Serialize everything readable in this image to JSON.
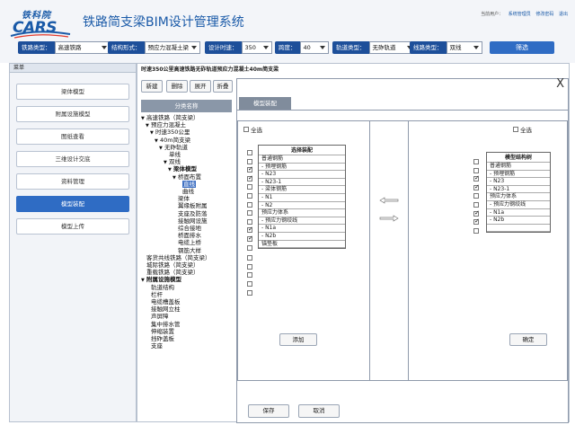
{
  "app": {
    "logo_cn": "铁科院",
    "logo_en": "CARS",
    "title": "铁路简支梁BIM设计管理系统"
  },
  "user": {
    "welcome": "当前用户：",
    "links": [
      "系统管理员",
      "修改密码",
      "退出"
    ]
  },
  "filters": [
    {
      "label": "铁路类型：",
      "value": "高速铁路"
    },
    {
      "label": "结构形式：",
      "value": "预应力混凝土梁"
    },
    {
      "label": "设计时速：",
      "value": "350"
    },
    {
      "label": "跨度：",
      "value": "40"
    },
    {
      "label": "轨道类型：",
      "value": "无砟轨道"
    },
    {
      "label": "线路类型：",
      "value": "双线"
    }
  ],
  "filter_button": "筛选",
  "sidebar": {
    "header": "菜单",
    "items": [
      {
        "label": "梁体模型",
        "active": false
      },
      {
        "label": "附属设施模型",
        "active": false
      },
      {
        "label": "图纸查看",
        "active": false
      },
      {
        "label": "三维设计交底",
        "active": false
      },
      {
        "label": "资料管理",
        "active": false
      },
      {
        "label": "模型装配",
        "active": true
      },
      {
        "label": "模型上传",
        "active": false
      }
    ]
  },
  "breadcrumb": "时速350公里高速铁路无砟轨道预应力混凝土40m简支梁",
  "tree_toolbar": [
    "新建",
    "删除",
    "展开",
    "折叠"
  ],
  "tree_header": "分类名称",
  "tree": [
    {
      "label": "高速铁路（简支梁）",
      "level": 0,
      "arrow": "▼",
      "bold": false,
      "selected": false
    },
    {
      "label": "预应力混凝土",
      "level": 1,
      "arrow": "▼",
      "bold": false,
      "selected": false
    },
    {
      "label": "时速350公里",
      "level": 2,
      "arrow": "▼",
      "bold": false,
      "selected": false
    },
    {
      "label": "40m简支梁",
      "level": 3,
      "arrow": "▼",
      "bold": false,
      "selected": false
    },
    {
      "label": "无砟轨道",
      "level": 4,
      "arrow": "▼",
      "bold": false,
      "selected": false
    },
    {
      "label": "单线",
      "level": 5,
      "arrow": "",
      "bold": false,
      "selected": false
    },
    {
      "label": "双线",
      "level": 5,
      "arrow": "▼",
      "bold": false,
      "selected": false
    },
    {
      "label": "梁体模型",
      "level": 6,
      "arrow": "▼",
      "bold": true,
      "selected": false
    },
    {
      "label": "桥面布置",
      "level": 7,
      "arrow": "▼",
      "bold": false,
      "selected": false
    },
    {
      "label": "直线",
      "level": 8,
      "arrow": "",
      "bold": false,
      "selected": true
    },
    {
      "label": "曲线",
      "level": 8,
      "arrow": "",
      "bold": false,
      "selected": false
    },
    {
      "label": "梁体",
      "level": 7,
      "arrow": "",
      "bold": false,
      "selected": false
    },
    {
      "label": "翼缘板附属",
      "level": 7,
      "arrow": "",
      "bold": false,
      "selected": false
    },
    {
      "label": "支座及防落",
      "level": 7,
      "arrow": "",
      "bold": false,
      "selected": false
    },
    {
      "label": "接触网设施",
      "level": 7,
      "arrow": "",
      "bold": false,
      "selected": false
    },
    {
      "label": "综合接地",
      "level": 7,
      "arrow": "",
      "bold": false,
      "selected": false
    },
    {
      "label": "桥面排水",
      "level": 7,
      "arrow": "",
      "bold": false,
      "selected": false
    },
    {
      "label": "电缆上桥",
      "level": 7,
      "arrow": "",
      "bold": false,
      "selected": false
    },
    {
      "label": "钢筋大样",
      "level": 7,
      "arrow": "",
      "bold": false,
      "selected": false
    },
    {
      "label": "客货共线铁路（简支梁）",
      "level": 0,
      "arrow": "",
      "bold": false,
      "selected": false
    },
    {
      "label": "城际铁路（简支梁）",
      "level": 0,
      "arrow": "",
      "bold": false,
      "selected": false
    },
    {
      "label": "重载铁路（简支梁）",
      "level": 0,
      "arrow": "",
      "bold": false,
      "selected": false
    },
    {
      "label": "附属设施模型",
      "level": 0,
      "arrow": "▼",
      "bold": true,
      "selected": false
    },
    {
      "label": "轨道结构",
      "level": 1,
      "arrow": "",
      "bold": false,
      "selected": false
    },
    {
      "label": "栏杆",
      "level": 1,
      "arrow": "",
      "bold": false,
      "selected": false
    },
    {
      "label": "电缆槽盖板",
      "level": 1,
      "arrow": "",
      "bold": false,
      "selected": false
    },
    {
      "label": "接触网立柱",
      "level": 1,
      "arrow": "",
      "bold": false,
      "selected": false
    },
    {
      "label": "声屏障",
      "level": 1,
      "arrow": "",
      "bold": false,
      "selected": false
    },
    {
      "label": "集中排水管",
      "level": 1,
      "arrow": "",
      "bold": false,
      "selected": false
    },
    {
      "label": "伸缩装置",
      "level": 1,
      "arrow": "",
      "bold": false,
      "selected": false
    },
    {
      "label": "挡砟盖板",
      "level": 1,
      "arrow": "",
      "bold": false,
      "selected": false
    },
    {
      "label": "支座",
      "level": 1,
      "arrow": "",
      "bold": false,
      "selected": false
    }
  ],
  "dialog": {
    "close": "X",
    "tab": "模型装配",
    "left": {
      "select_all": "全选",
      "table_title": "选择装配",
      "rows": [
        {
          "label": "普通钢筋",
          "checked": false
        },
        {
          "label": "- 预埋钢筋",
          "checked": false
        },
        {
          "label": "- N23",
          "checked": true
        },
        {
          "label": "- N23-1",
          "checked": true
        },
        {
          "label": "- 梁体钢筋",
          "checked": false
        },
        {
          "label": "- N1",
          "checked": false
        },
        {
          "label": "- N2",
          "checked": false
        },
        {
          "label": "预应力体系",
          "checked": false
        },
        {
          "label": "- 预应力钢绞线",
          "checked": false
        },
        {
          "label": "- N1a",
          "checked": true
        },
        {
          "label": "- N2b",
          "checked": true
        },
        {
          "label": "锚垫板",
          "checked": false
        }
      ],
      "extra_checkboxes": 5,
      "button": "添加"
    },
    "right": {
      "select_all": "全选",
      "table_title": "模型结构树",
      "rows": [
        {
          "label": "普通钢筋",
          "checked": false
        },
        {
          "label": "- 预埋钢筋",
          "checked": false
        },
        {
          "label": "- N23",
          "checked": true
        },
        {
          "label": "- N23-1",
          "checked": true
        },
        {
          "label": "预应力体系",
          "checked": false
        },
        {
          "label": "- 预应力钢绞线",
          "checked": false
        },
        {
          "label": "- N1a",
          "checked": true
        },
        {
          "label": "- N2b",
          "checked": true
        },
        {
          "label": "",
          "checked": false
        }
      ],
      "button": "确定"
    },
    "save": "保存",
    "cancel": "取消"
  }
}
